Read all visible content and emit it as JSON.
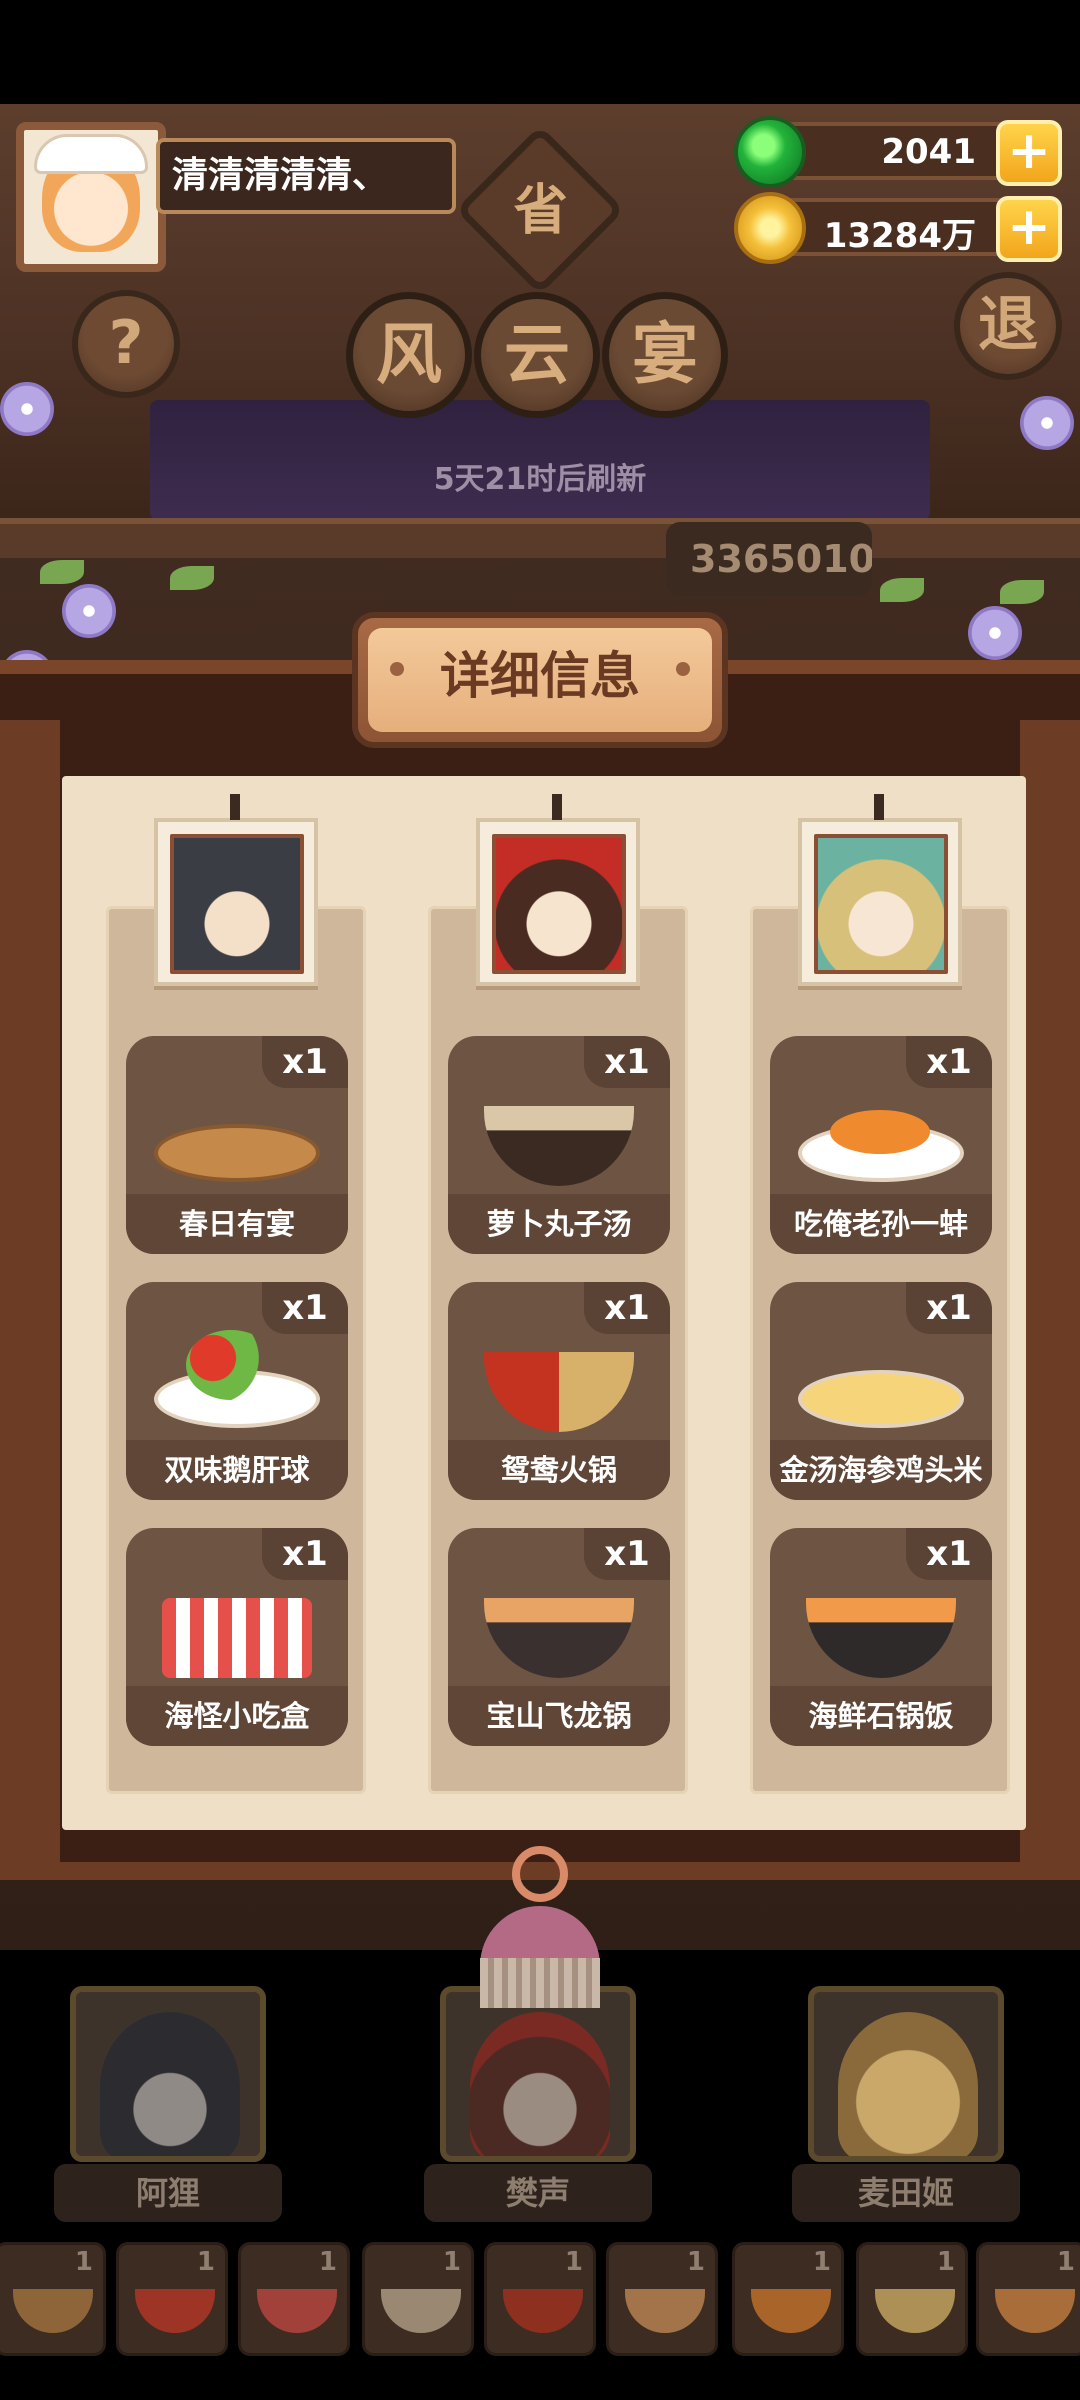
{
  "player": {
    "name": "清清清清清、"
  },
  "currency": {
    "jade": "2041",
    "coins": "13284万"
  },
  "buttons": {
    "help": "?",
    "exit": "退"
  },
  "title": {
    "province_tag": "省",
    "chars": [
      "风",
      "云",
      "宴"
    ]
  },
  "refresh_text": "5天21时后刷新",
  "score": "3365010",
  "panel": {
    "header": "详细信息",
    "columns": [
      {
        "dishes": [
          {
            "name": "春日有宴",
            "count": "x1"
          },
          {
            "name": "双味鹅肝球",
            "count": "x1"
          },
          {
            "name": "海怪小吃盒",
            "count": "x1"
          }
        ]
      },
      {
        "dishes": [
          {
            "name": "萝卜丸子汤",
            "count": "x1"
          },
          {
            "name": "鸳鸯火锅",
            "count": "x1"
          },
          {
            "name": "宝山飞龙锅",
            "count": "x1"
          }
        ]
      },
      {
        "dishes": [
          {
            "name": "吃俺老孙一蚌",
            "count": "x1"
          },
          {
            "name": "金汤海参鸡头米",
            "count": "x1"
          },
          {
            "name": "海鲜石锅饭",
            "count": "x1"
          }
        ]
      }
    ]
  },
  "characters": [
    {
      "name": "阿狸"
    },
    {
      "name": "樊声"
    },
    {
      "name": "麦田姬"
    }
  ],
  "slots": [
    "1",
    "1",
    "1",
    "1",
    "1",
    "1",
    "1",
    "1",
    "1"
  ],
  "colors": {
    "panel_bg": "#efdfc6",
    "card_bg": "#6e5443",
    "header_text": "#6a3a22"
  }
}
